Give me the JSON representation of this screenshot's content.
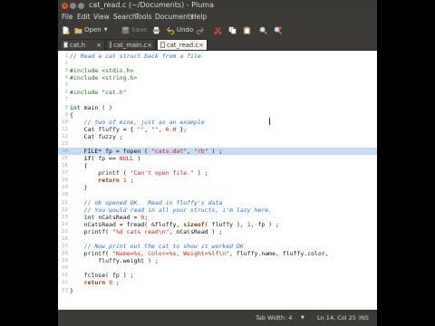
{
  "window": {
    "title": "cat_read.c (~/Documents) - Pluma"
  },
  "menu": [
    "File",
    "Edit",
    "View",
    "Search",
    "Tools",
    "Documents",
    "Help"
  ],
  "toolbar": {
    "open_label": "Open",
    "save_label": "Save",
    "undo_label": "Undo"
  },
  "tabs": [
    {
      "label": "cat.h",
      "active": false
    },
    {
      "label": "cat_main.c",
      "active": false
    },
    {
      "label": "cat_read.c",
      "active": true
    }
  ],
  "editor": {
    "current_line": 14,
    "lines": [
      {
        "n": 1,
        "parts": [
          [
            "cm",
            "// Read a cat struct back from a file"
          ]
        ]
      },
      {
        "n": 2,
        "parts": []
      },
      {
        "n": 3,
        "parts": [
          [
            "pp",
            "#include <stdio.h>"
          ]
        ]
      },
      {
        "n": 4,
        "parts": [
          [
            "pp",
            "#include <string.h>"
          ]
        ]
      },
      {
        "n": 5,
        "parts": []
      },
      {
        "n": 6,
        "parts": [
          [
            "pp",
            "#include \"cat.h\""
          ]
        ]
      },
      {
        "n": 7,
        "parts": []
      },
      {
        "n": 8,
        "parts": [
          [
            "ty",
            "int"
          ],
          [
            "",
            " main ( )"
          ]
        ]
      },
      {
        "n": 9,
        "parts": [
          [
            "",
            "{"
          ]
        ]
      },
      {
        "n": 10,
        "parts": [
          [
            "cm",
            "    // two of mine, just as an example"
          ]
        ]
      },
      {
        "n": 11,
        "parts": [
          [
            "",
            "    Cat fluffy = { "
          ],
          [
            "st",
            "\"\""
          ],
          [
            "",
            ", "
          ],
          [
            "st",
            "\"\""
          ],
          [
            "",
            ", "
          ],
          [
            "nm",
            "0.0"
          ],
          [
            "",
            " };"
          ]
        ]
      },
      {
        "n": 12,
        "parts": [
          [
            "",
            "    Cat fuzzy ;"
          ]
        ]
      },
      {
        "n": 13,
        "parts": []
      },
      {
        "n": 14,
        "parts": [
          [
            "",
            "    FILE* fp = fopen ( "
          ],
          [
            "st",
            "\"cats.dat\""
          ],
          [
            "",
            ", "
          ],
          [
            "st",
            "\"rb\""
          ],
          [
            "",
            " ) ;"
          ]
        ]
      },
      {
        "n": 15,
        "parts": [
          [
            "",
            "    "
          ],
          [
            "kw",
            "if"
          ],
          [
            "",
            "( fp == "
          ],
          [
            "nm",
            "NULL"
          ],
          [
            "",
            " )"
          ]
        ]
      },
      {
        "n": 16,
        "parts": [
          [
            "",
            "    {"
          ]
        ]
      },
      {
        "n": 17,
        "parts": [
          [
            "",
            "        printf ( "
          ],
          [
            "st",
            "\"Can't open file.\""
          ],
          [
            "",
            " ) ;"
          ]
        ]
      },
      {
        "n": 18,
        "parts": [
          [
            "",
            "        "
          ],
          [
            "kw",
            "return"
          ],
          [
            "",
            " "
          ],
          [
            "nm",
            "1"
          ],
          [
            "",
            " ;"
          ]
        ]
      },
      {
        "n": 19,
        "parts": [
          [
            "",
            "    }"
          ]
        ]
      },
      {
        "n": 20,
        "parts": []
      },
      {
        "n": 21,
        "parts": [
          [
            "cm",
            "    // ok opened OK.  Read in fluffy's data"
          ]
        ]
      },
      {
        "n": 22,
        "parts": [
          [
            "cm",
            "    // You would read in all your structs, i'm lazy here."
          ]
        ]
      },
      {
        "n": 23,
        "parts": [
          [
            "",
            "    "
          ],
          [
            "ty",
            "int"
          ],
          [
            "",
            " nCatsRead = "
          ],
          [
            "nm",
            "0"
          ],
          [
            "",
            ";"
          ]
        ]
      },
      {
        "n": 24,
        "parts": [
          [
            "",
            "    nCatsRead = fread( &fluffy, "
          ],
          [
            "kw",
            "sizeof"
          ],
          [
            "",
            "( fluffy ), "
          ],
          [
            "nm",
            "1"
          ],
          [
            "",
            ", fp ) ;"
          ]
        ]
      },
      {
        "n": 25,
        "parts": [
          [
            "",
            "    printf( "
          ],
          [
            "st",
            "\"%d cats read\\n\""
          ],
          [
            "",
            ", nCatsRead ) ;"
          ]
        ]
      },
      {
        "n": 26,
        "parts": []
      },
      {
        "n": 27,
        "parts": [
          [
            "cm",
            "    // Now print out the cat to show it worked OK"
          ]
        ]
      },
      {
        "n": 28,
        "parts": [
          [
            "",
            "    printf( "
          ],
          [
            "st",
            "\"Name=%s, Color=%s, Weight=%lf\\n\""
          ],
          [
            "",
            ", fluffy.name, fluffy.color,"
          ]
        ]
      },
      {
        "n": 29,
        "parts": [
          [
            "",
            "        fluffy.weight ) ;"
          ]
        ]
      },
      {
        "n": 30,
        "parts": []
      },
      {
        "n": 31,
        "parts": [
          [
            "",
            "    fclose( fp ) ;"
          ]
        ]
      },
      {
        "n": 32,
        "parts": [
          [
            "",
            "    "
          ],
          [
            "kw",
            "return"
          ],
          [
            "",
            " "
          ],
          [
            "nm",
            "0"
          ],
          [
            "",
            " ;"
          ]
        ]
      },
      {
        "n": 33,
        "parts": [
          [
            "",
            "}"
          ]
        ]
      }
    ]
  },
  "statusbar": {
    "tab_width": "Tab Width: 4",
    "position": "Ln 14, Col 25",
    "mode": "INS"
  },
  "colors": {
    "accent": "#e95420",
    "current_line": "#c6dbf5",
    "chrome": "#3c3b37"
  }
}
